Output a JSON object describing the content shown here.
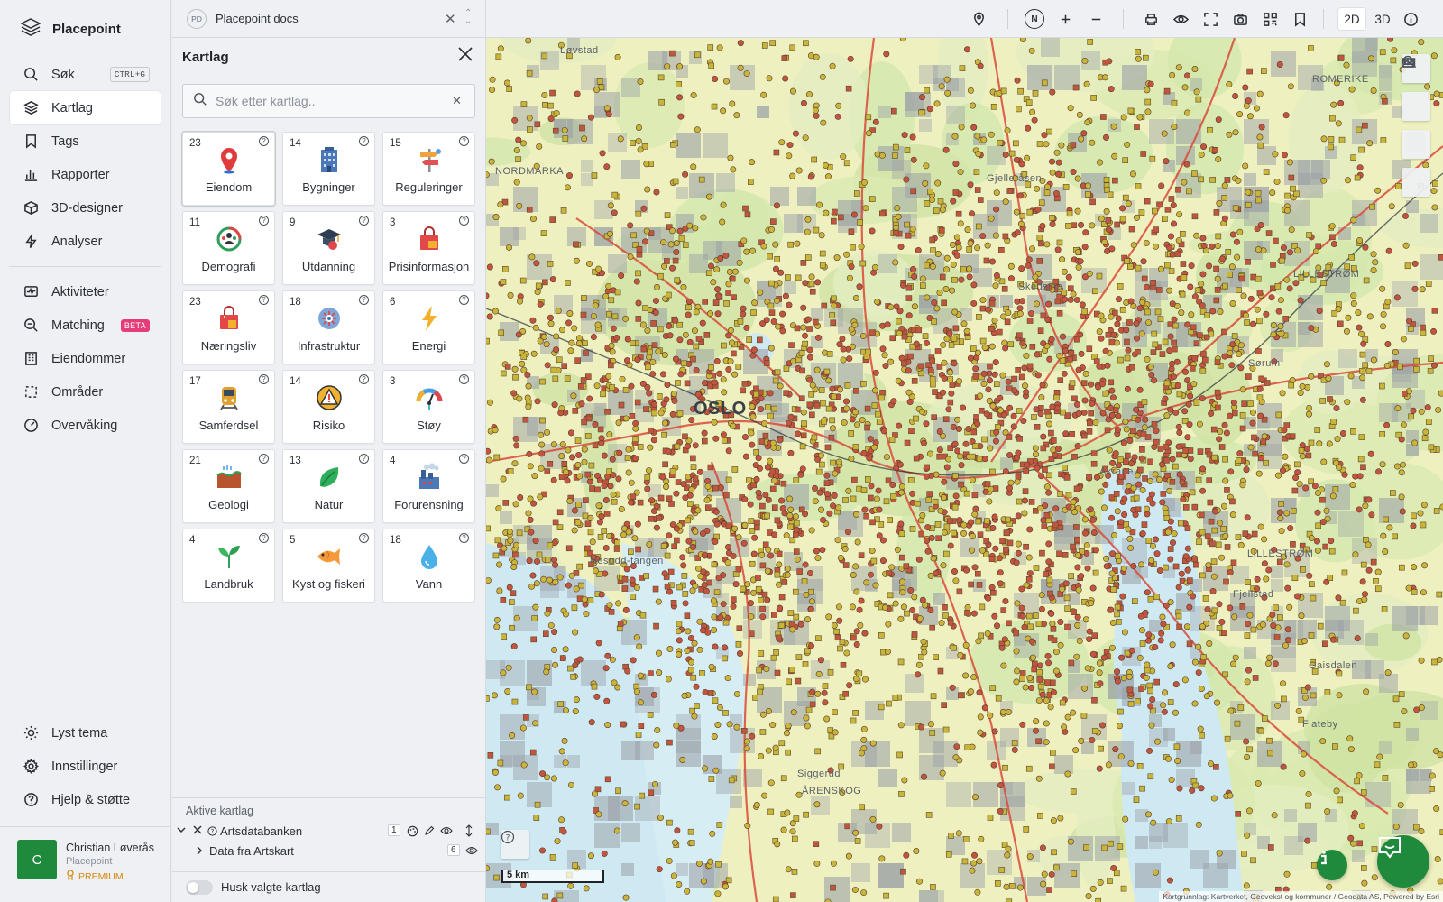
{
  "app": {
    "name": "Placepoint"
  },
  "nav": {
    "search": {
      "label": "Søk",
      "shortcut": "CTRL+G"
    },
    "items": [
      {
        "label": "Kartlag",
        "icon": "layers-icon",
        "active": true
      },
      {
        "label": "Tags",
        "icon": "bookmark-icon"
      },
      {
        "label": "Rapporter",
        "icon": "bar-chart-icon"
      },
      {
        "label": "3D-designer",
        "icon": "cube-icon"
      },
      {
        "label": "Analyser",
        "icon": "lightning-icon"
      }
    ],
    "items2": [
      {
        "label": "Aktiviteter",
        "icon": "activity-icon"
      },
      {
        "label": "Matching",
        "icon": "search-zoom-icon",
        "badge": "BETA"
      },
      {
        "label": "Eiendommer",
        "icon": "building-icon"
      },
      {
        "label": "Områder",
        "icon": "area-icon"
      },
      {
        "label": "Overvåking",
        "icon": "gauge-icon"
      }
    ],
    "bottom": [
      {
        "label": "Lyst tema",
        "icon": "sun-icon"
      },
      {
        "label": "Innstillinger",
        "icon": "gear-icon"
      },
      {
        "label": "Hjelp & støtte",
        "icon": "help-icon"
      }
    ],
    "user": {
      "initial": "C",
      "name": "Christian Løverås",
      "org": "Placepoint",
      "plan": "PREMIUM"
    }
  },
  "doc": {
    "badge": "PD",
    "title": "Placepoint docs"
  },
  "panel": {
    "title": "Kartlag",
    "search_placeholder": "Søk etter kartlag..",
    "categories": [
      {
        "count": "23",
        "label": "Eiendom",
        "icon": "map-pin-icon"
      },
      {
        "count": "14",
        "label": "Bygninger",
        "icon": "building-icon"
      },
      {
        "count": "15",
        "label": "Reguleringer",
        "icon": "signpost-icon"
      },
      {
        "count": "11",
        "label": "Demografi",
        "icon": "demography-icon"
      },
      {
        "count": "9",
        "label": "Utdanning",
        "icon": "graduation-cap-icon"
      },
      {
        "count": "3",
        "label": "Prisinformasjon",
        "icon": "shopping-bag-icon"
      },
      {
        "count": "23",
        "label": "Næringsliv",
        "icon": "shop-icon"
      },
      {
        "count": "18",
        "label": "Infrastruktur",
        "icon": "infrastructure-icon"
      },
      {
        "count": "6",
        "label": "Energi",
        "icon": "lightning-icon"
      },
      {
        "count": "17",
        "label": "Samferdsel",
        "icon": "train-icon"
      },
      {
        "count": "14",
        "label": "Risiko",
        "icon": "warning-icon"
      },
      {
        "count": "3",
        "label": "Støy",
        "icon": "noise-gauge-icon"
      },
      {
        "count": "21",
        "label": "Geologi",
        "icon": "soil-icon"
      },
      {
        "count": "13",
        "label": "Natur",
        "icon": "leaf-icon"
      },
      {
        "count": "4",
        "label": "Forurensning",
        "icon": "factory-icon"
      },
      {
        "count": "4",
        "label": "Landbruk",
        "icon": "sprout-icon"
      },
      {
        "count": "5",
        "label": "Kyst og fiskeri",
        "icon": "fish-icon"
      },
      {
        "count": "18",
        "label": "Vann",
        "icon": "water-drop-icon"
      }
    ],
    "active_title": "Aktive kartlag",
    "active_layers": [
      {
        "name": "Artsdatabanken",
        "count": "1",
        "sublayer": "Data fra Artskart",
        "sub_count": "6"
      }
    ],
    "remember_label": "Husk valgte kartlag"
  },
  "toolbar": {
    "mode_2d": "2D",
    "mode_3d": "3D",
    "compass": "N"
  },
  "map": {
    "scale_label": "5 km",
    "attribution": "Kartgrunnlag: Kartverket, Geovekst og kommuner / Geodata AS, Powered by Esri",
    "places": [
      {
        "label": "Løvstad"
      },
      {
        "label": "ROMERIKE"
      },
      {
        "label": "OSLO"
      },
      {
        "label": "LILLESTRØM"
      },
      {
        "label": "NORDMARKA"
      },
      {
        "label": "Nesodd-tangen"
      },
      {
        "label": "Skedsmo"
      },
      {
        "label": "Gjelleråsen"
      },
      {
        "label": "Akrane"
      },
      {
        "label": "ÅRENSKOG"
      },
      {
        "label": "Gaisdalen"
      },
      {
        "label": "Fjellstad"
      },
      {
        "label": "LILLESTRØM"
      },
      {
        "label": "Siggerud"
      },
      {
        "label": "Flateby"
      },
      {
        "label": "Sørum"
      }
    ]
  }
}
